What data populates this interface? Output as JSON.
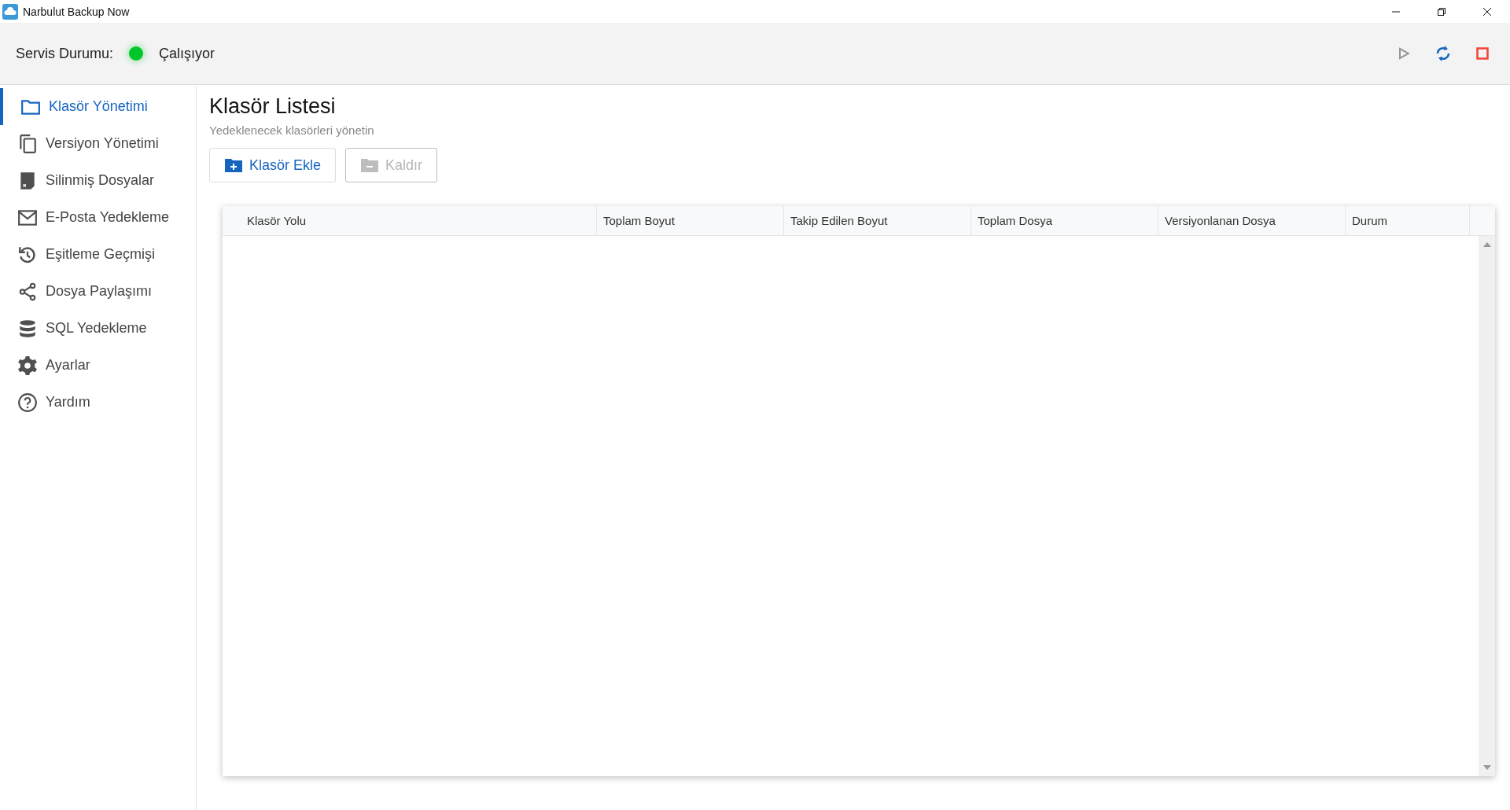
{
  "window": {
    "title": "Narbulut Backup Now"
  },
  "service": {
    "label": "Servis Durumu:",
    "running": true,
    "status": "Çalışıyor"
  },
  "toolbar_buttons": [
    {
      "kind": "play",
      "disabled": true
    },
    {
      "kind": "refresh",
      "disabled": false
    },
    {
      "kind": "stop",
      "disabled": false
    }
  ],
  "sidebar": {
    "items": [
      {
        "kind": "folder",
        "label": "Klasör Yönetimi",
        "selected": true
      },
      {
        "kind": "copy",
        "label": "Versiyon Yönetimi",
        "selected": false
      },
      {
        "kind": "deleted",
        "label": "Silinmiş Dosyalar",
        "selected": false
      },
      {
        "kind": "mail",
        "label": "E-Posta Yedekleme",
        "selected": false
      },
      {
        "kind": "history",
        "label": "Eşitleme Geçmişi",
        "selected": false
      },
      {
        "kind": "share",
        "label": "Dosya Paylaşımı",
        "selected": false
      },
      {
        "kind": "database",
        "label": "SQL Yedekleme",
        "selected": false
      },
      {
        "kind": "gear",
        "label": "Ayarlar",
        "selected": false
      },
      {
        "kind": "help",
        "label": "Yardım",
        "selected": false
      }
    ]
  },
  "page": {
    "title": "Klasör Listesi",
    "subtitle": "Yedeklenecek klasörleri yönetin"
  },
  "buttons": [
    {
      "kind": "add",
      "label": "Klasör Ekle",
      "disabled": false
    },
    {
      "kind": "remove",
      "label": "Kaldır",
      "disabled": true
    }
  ],
  "table": {
    "columns": [
      "Klasör Yolu",
      "Toplam Boyut",
      "Takip Edilen Boyut",
      "Toplam Dosya",
      "Versiyonlanan Dosya",
      "Durum"
    ]
  }
}
